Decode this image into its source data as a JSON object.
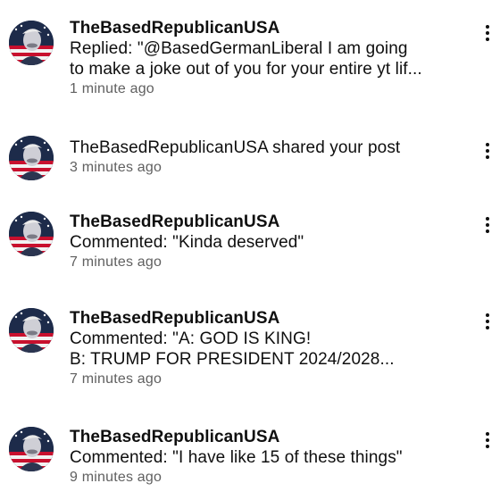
{
  "notifications": [
    {
      "username": "TheBasedRepublicanUSA",
      "line1": "Replied: \"@BasedGermanLiberal  I am going",
      "line2": "to make a joke out of you for your entire yt lif...",
      "time": "1 minute ago"
    },
    {
      "line1": "TheBasedRepublicanUSA shared your post",
      "time": "3 minutes ago"
    },
    {
      "username": "TheBasedRepublicanUSA",
      "line1": "Commented: \"Kinda deserved\"",
      "time": "7 minutes ago"
    },
    {
      "username": "TheBasedRepublicanUSA",
      "line1": "Commented: \"A: GOD IS KING!",
      "line2": "B: TRUMP FOR PRESIDENT 2024/2028...",
      "time": "7 minutes ago"
    },
    {
      "username": "TheBasedRepublicanUSA",
      "line1": "Commented: \"I have like 15 of these things\"",
      "time": "9 minutes ago"
    }
  ]
}
